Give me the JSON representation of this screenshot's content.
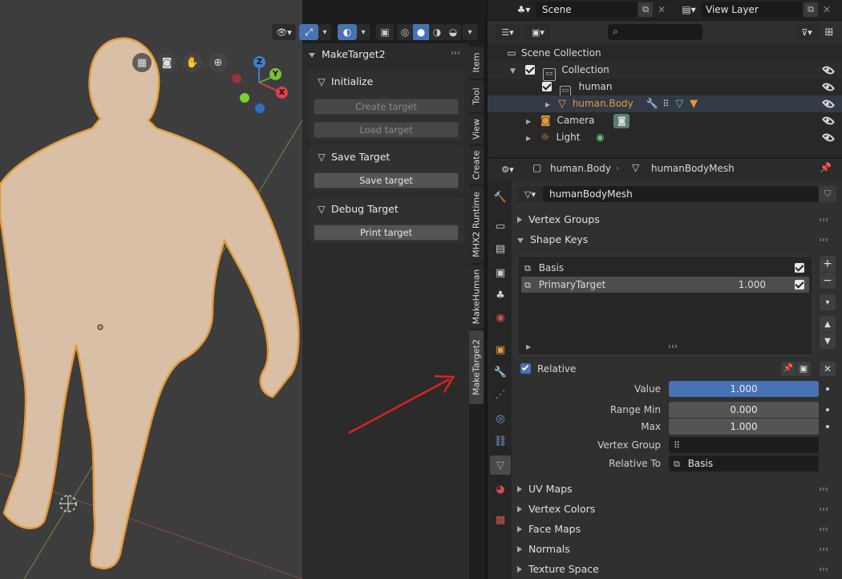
{
  "top_bar": {
    "scene_label": "Scene",
    "view_layer_label": "View Layer"
  },
  "makehuman_panel": {
    "title": "MakeTarget2",
    "sections": [
      {
        "title": "Initialize",
        "buttons": [
          "Create target",
          "Load target"
        ]
      },
      {
        "title": "Save Target",
        "buttons": [
          "Save target"
        ]
      },
      {
        "title": "Debug Target",
        "buttons": [
          "Print target"
        ]
      }
    ]
  },
  "sidebar_tabs": [
    "Item",
    "Tool",
    "View",
    "Create",
    "MHX2 Runtime",
    "MakeHuman",
    "MakeTarget2"
  ],
  "gizmo": {
    "z": "Z",
    "y": "Y",
    "x": "X"
  },
  "outliner": {
    "scene_collection": "Scene Collection",
    "collection": "Collection",
    "human": "human",
    "human_body": "human.Body",
    "camera": "Camera",
    "light": "Light"
  },
  "properties": {
    "breadcrumb_object": "human.Body",
    "breadcrumb_mesh": "humanBodyMesh",
    "mesh_name": "humanBodyMesh",
    "sections": {
      "vertex_groups": "Vertex Groups",
      "shape_keys": "Shape Keys",
      "uv_maps": "UV Maps",
      "vertex_colors": "Vertex Colors",
      "face_maps": "Face Maps",
      "normals": "Normals",
      "texture_space": "Texture Space"
    },
    "shape_keys": [
      {
        "name": "Basis",
        "value": ""
      },
      {
        "name": "PrimaryTarget",
        "value": "1.000"
      }
    ],
    "relative_label": "Relative",
    "value_label": "Value",
    "value": "1.000",
    "value_fraction": 1.0,
    "range_min_label": "Range Min",
    "range_min": "0.000",
    "max_label": "Max",
    "max": "1.000",
    "vertex_group_label": "Vertex Group",
    "vertex_group_value": "",
    "relative_to_label": "Relative To",
    "relative_to_value": "Basis"
  },
  "colors": {
    "accent_blue": "#4772b3",
    "object_orange": "#e39b3a",
    "annotation_red": "#e02020",
    "mesh_green": "#6cc37c",
    "skin": "#d9bfa6"
  }
}
